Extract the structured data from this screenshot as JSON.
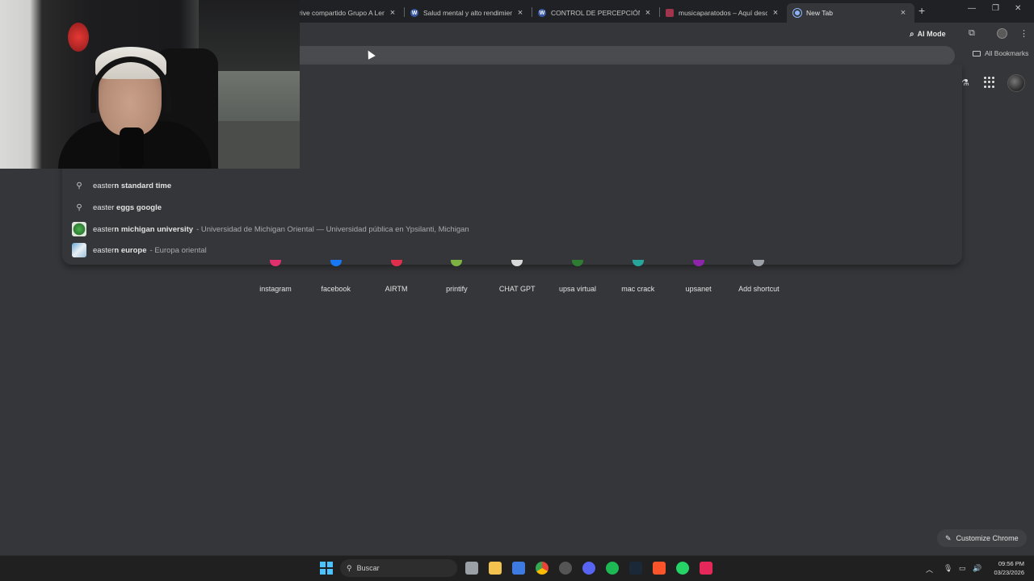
{
  "tabs": [
    {
      "title": "rive compartido Grupo A Lengu",
      "favicon": "drive-icon",
      "active": false
    },
    {
      "title": "Salud mental y alto rendimient",
      "favicon": "wordpress-icon",
      "active": false
    },
    {
      "title": "CONTROL DE PERCEPCIÓN",
      "favicon": "wordpress-icon",
      "active": false
    },
    {
      "title": "musicaparatodos – Aquí descu",
      "favicon": "site-icon",
      "active": false
    },
    {
      "title": "New Tab",
      "favicon": "chrome-icon",
      "active": true
    }
  ],
  "new_tab_symbol": "+",
  "window_controls": {
    "minimize": "—",
    "restore": "❐",
    "close": "✕"
  },
  "toolbar": {
    "ai_mode_label": "AI Mode",
    "bookmarks_label": "All Bookmarks"
  },
  "omnibox": {
    "value": ""
  },
  "suggestions": [
    {
      "typed": "easter",
      "completion": "n standard time",
      "description": "",
      "icon": "search-icon"
    },
    {
      "typed": "easter ",
      "completion": "eggs google",
      "description": "",
      "icon": "search-icon"
    },
    {
      "typed": "easter",
      "completion": "n michigan university",
      "description": "- Universidad de Michigan Oriental — Universidad pública en Ypsilanti, Michigan",
      "icon": "emu-thumbnail"
    },
    {
      "typed": "easter",
      "completion": "n europe",
      "description": "- Europa oriental",
      "icon": "europe-thumbnail"
    }
  ],
  "shortcuts": [
    {
      "label": "instagram",
      "color": "#e1306c"
    },
    {
      "label": "facebook",
      "color": "#1877f2"
    },
    {
      "label": "AIRTM",
      "color": "#e02f4c"
    },
    {
      "label": "printify",
      "color": "#7cb342"
    },
    {
      "label": "CHAT GPT",
      "color": "#d9d9d9"
    },
    {
      "label": "upsa virtual",
      "color": "#2e7d32"
    },
    {
      "label": "mac crack",
      "color": "#26a69a"
    },
    {
      "label": "upsanet",
      "color": "#8e24aa"
    },
    {
      "label": "Add shortcut",
      "color": "#9aa0a6"
    }
  ],
  "customize_label": "Customize Chrome",
  "taskbar": {
    "search_placeholder": "Buscar",
    "time": "09:56 PM",
    "date": "03/23/2026"
  },
  "colors": {
    "page_bg": "#35363a",
    "tabstrip_bg": "#202124",
    "omnibox_bg": "#4a4b4f",
    "taskbar_bg": "#202020"
  }
}
